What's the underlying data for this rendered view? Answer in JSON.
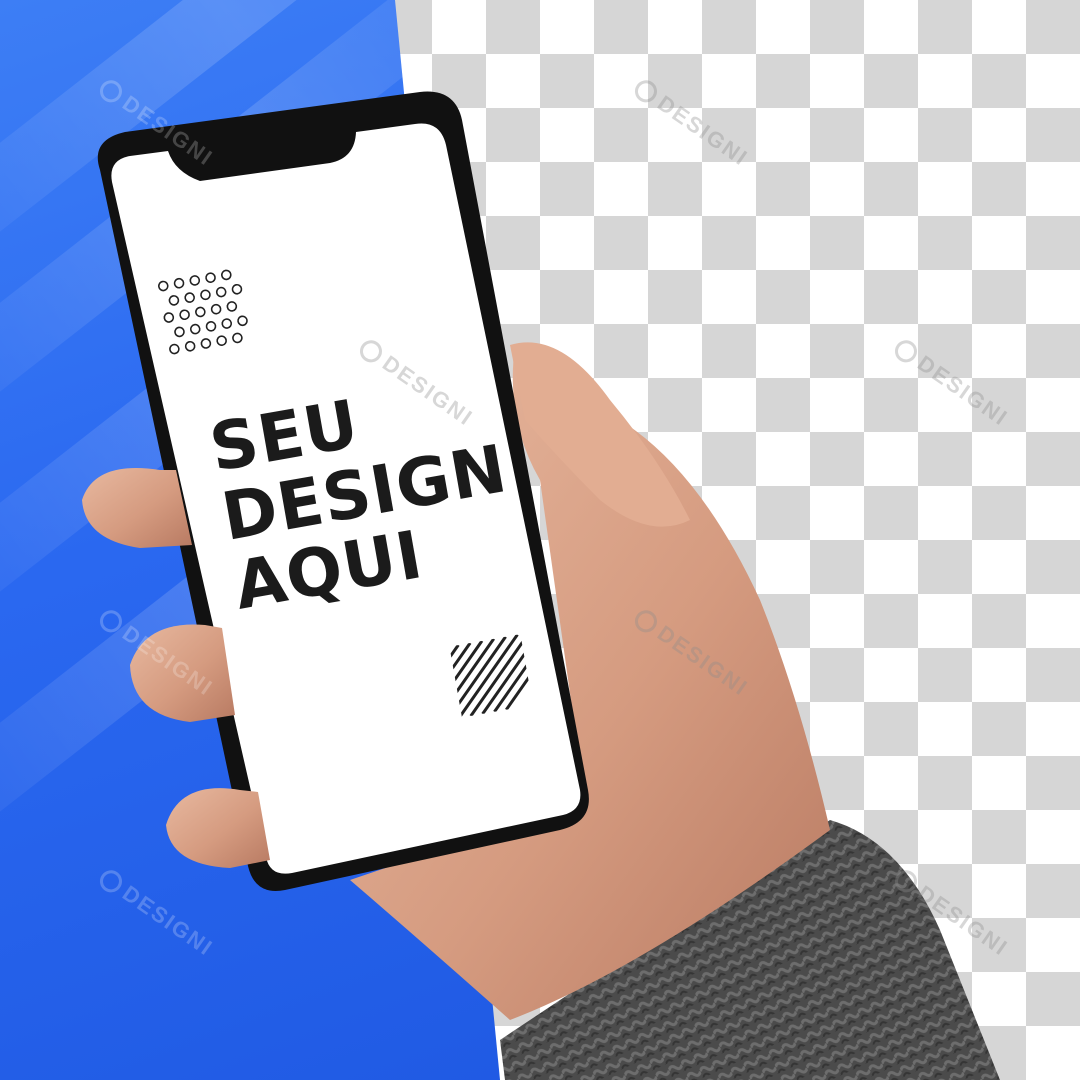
{
  "screen": {
    "headline_lines": [
      "SEU",
      "DESIGN",
      "AQUI"
    ]
  },
  "watermark": {
    "text": "DESIGNI"
  },
  "colors": {
    "background_blue": "#2a68f0",
    "checker_gray": "#d6d6d6",
    "phone_body": "#111111",
    "sweater": "#4a4a4a",
    "skin": "#d9a58a",
    "headline": "#1b1b1b"
  }
}
